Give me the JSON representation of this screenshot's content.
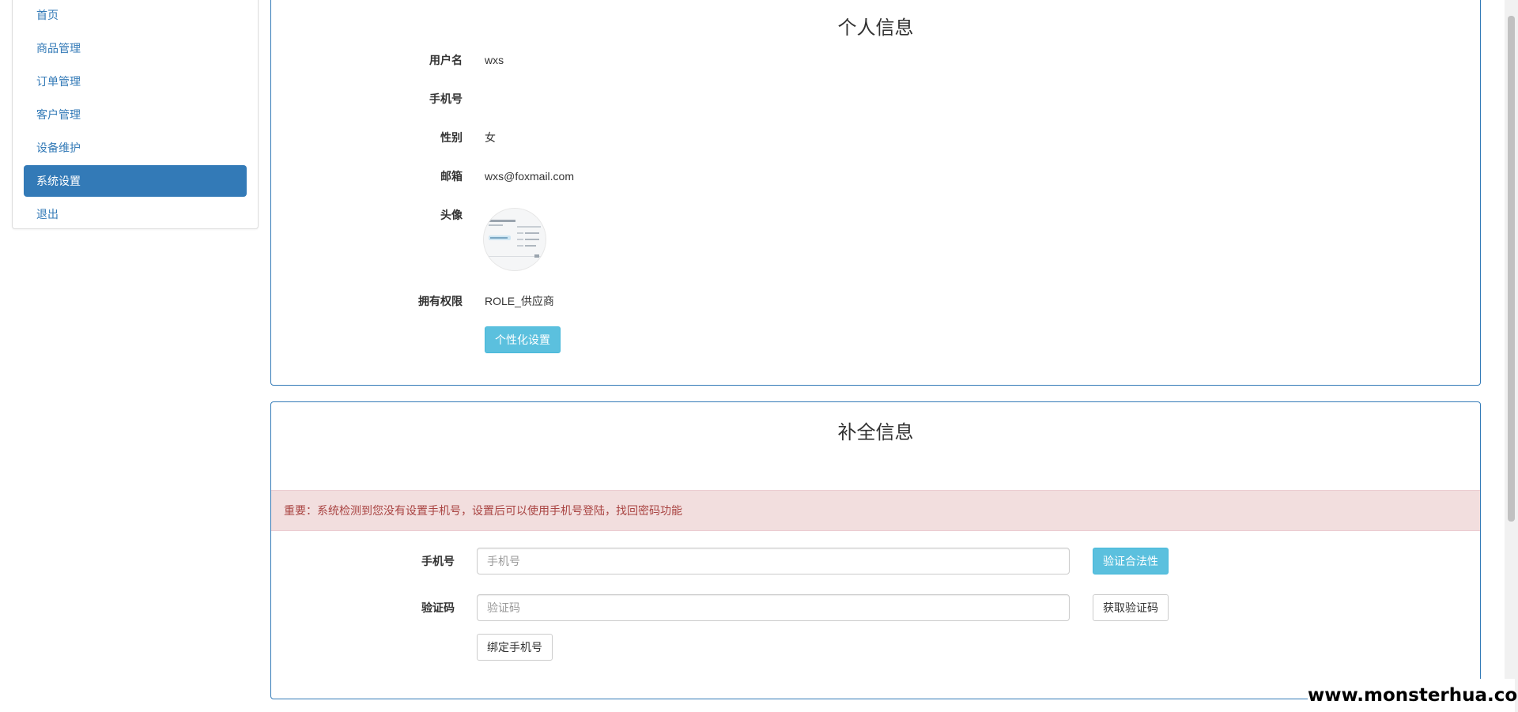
{
  "sidebar": {
    "items": [
      {
        "label": "首页",
        "active": false
      },
      {
        "label": "商品管理",
        "active": false
      },
      {
        "label": "订单管理",
        "active": false
      },
      {
        "label": "客户管理",
        "active": false
      },
      {
        "label": "设备维护",
        "active": false
      },
      {
        "label": "系统设置",
        "active": true
      },
      {
        "label": "退出",
        "active": false
      }
    ]
  },
  "profile": {
    "title": "个人信息",
    "rows": [
      {
        "label": "用户名",
        "value": "wxs"
      },
      {
        "label": "手机号",
        "value": ""
      },
      {
        "label": "性别",
        "value": "女"
      },
      {
        "label": "邮箱",
        "value": "wxs@foxmail.com"
      },
      {
        "label": "头像",
        "value": ""
      },
      {
        "label": "拥有权限",
        "value": "ROLE_供应商"
      }
    ],
    "settings_button": "个性化设置"
  },
  "complete": {
    "title": "补全信息",
    "alert": "重要：系统检测到您没有设置手机号，设置后可以使用手机号登陆，找回密码功能",
    "phone_label": "手机号",
    "phone_placeholder": "手机号",
    "phone_value": "",
    "validate_button": "验证合法性",
    "code_label": "验证码",
    "code_placeholder": "验证码",
    "code_value": "",
    "get_code_button": "获取验证码",
    "bind_button": "绑定手机号"
  },
  "watermark": "www.monsterhua.com",
  "colors": {
    "primary": "#337ab7",
    "info": "#5bc0de",
    "alert_bg": "#f2dede",
    "alert_text": "#a94442"
  }
}
